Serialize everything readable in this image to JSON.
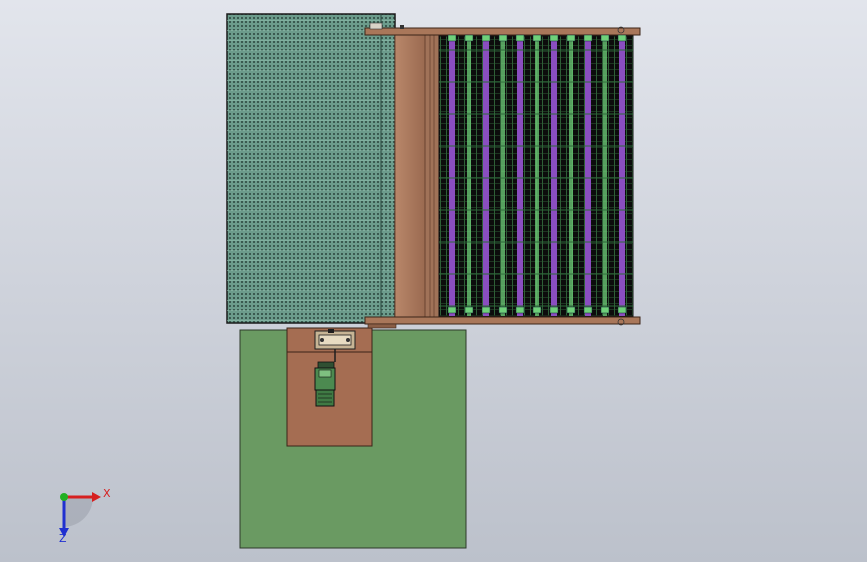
{
  "viewport": {
    "background_top": "#e2e5ec",
    "background_bottom": "#bcc1cb"
  },
  "colors": {
    "mesh_panel_fill": "#6c9c8c",
    "mesh_panel_hole": "#3a5a50",
    "wood_frame": "#a9775a",
    "wood_frame_dark": "#6a4330",
    "base_plate": "#6a9a62",
    "base_plate_edge": "#2d3a2a",
    "drive_plate": "#a56d52",
    "roller_purple": "#8a4ec0",
    "roller_green": "#6fd07a",
    "roller_bed": "#0c0c0c",
    "motor_green": "#4c8a50",
    "axis_x": "#d62020",
    "axis_y": "#22b022",
    "axis_z": "#2030d0"
  },
  "icons": {
    "triad": "coordinate-triad-icon",
    "motor": "gear-motor-icon",
    "coupling": "coupling-icon"
  },
  "triad": {
    "x_label": "X",
    "z_label": "Z"
  }
}
